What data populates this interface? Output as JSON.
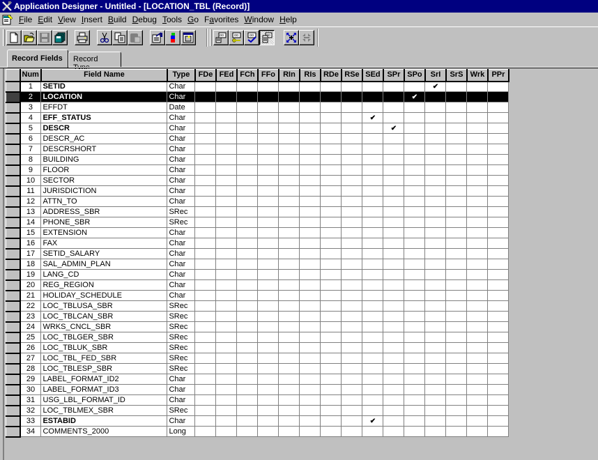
{
  "window": {
    "title": "Application Designer - Untitled - [LOCATION_TBL (Record)]"
  },
  "menu": [
    {
      "label": "File",
      "accel": "F"
    },
    {
      "label": "Edit",
      "accel": "E"
    },
    {
      "label": "View",
      "accel": "V"
    },
    {
      "label": "Insert",
      "accel": "I"
    },
    {
      "label": "Build",
      "accel": "B"
    },
    {
      "label": "Debug",
      "accel": "D"
    },
    {
      "label": "Tools",
      "accel": "T"
    },
    {
      "label": "Go",
      "accel": "G"
    },
    {
      "label": "Favorites",
      "accel": "a"
    },
    {
      "label": "Window",
      "accel": "W"
    },
    {
      "label": "Help",
      "accel": "H"
    }
  ],
  "toolbar": {
    "buttons": [
      {
        "name": "new-icon",
        "enabled": true
      },
      {
        "name": "open-icon",
        "enabled": true
      },
      {
        "name": "save-icon",
        "enabled": false
      },
      {
        "name": "save-all-icon",
        "enabled": true
      },
      {
        "name": "print-icon",
        "enabled": true
      },
      {
        "name": "cut-icon",
        "enabled": true
      },
      {
        "name": "copy-icon",
        "enabled": true
      },
      {
        "name": "paste-icon",
        "enabled": false
      },
      {
        "name": "properties-icon",
        "enabled": true
      },
      {
        "name": "build-icon",
        "enabled": true
      },
      {
        "name": "project-icon",
        "enabled": true
      },
      {
        "name": "view-field-display-icon",
        "enabled": true
      },
      {
        "name": "view-key-icon",
        "enabled": true
      },
      {
        "name": "view-validation-icon",
        "enabled": true
      },
      {
        "name": "view-pcode-icon",
        "enabled": true,
        "pressed": true
      },
      {
        "name": "expand-icon",
        "enabled": true
      },
      {
        "name": "collapse-icon",
        "enabled": false
      }
    ]
  },
  "tabs": [
    {
      "label": "Record Fields",
      "active": true
    },
    {
      "label": "Record Type",
      "active": false
    }
  ],
  "grid": {
    "columns": [
      "Num",
      "Field Name",
      "Type",
      "FDe",
      "FEd",
      "FCh",
      "FFo",
      "RIn",
      "RIs",
      "RDe",
      "RSe",
      "SEd",
      "SPr",
      "SPo",
      "SrI",
      "SrS",
      "Wrk",
      "PPr"
    ],
    "check_mark": "✔",
    "selected_row": 2,
    "rows": [
      {
        "num": "1",
        "name": "SETID",
        "type": "Char",
        "bold": true,
        "checks": [
          "SrI"
        ]
      },
      {
        "num": "2",
        "name": "LOCATION",
        "type": "Char",
        "bold": true,
        "checks": [
          "SPo"
        ]
      },
      {
        "num": "3",
        "name": "EFFDT",
        "type": "Date",
        "bold": false,
        "checks": []
      },
      {
        "num": "4",
        "name": "EFF_STATUS",
        "type": "Char",
        "bold": true,
        "checks": [
          "SEd"
        ]
      },
      {
        "num": "5",
        "name": "DESCR",
        "type": "Char",
        "bold": true,
        "checks": [
          "SPr"
        ]
      },
      {
        "num": "6",
        "name": "DESCR_AC",
        "type": "Char",
        "bold": false,
        "checks": []
      },
      {
        "num": "7",
        "name": "DESCRSHORT",
        "type": "Char",
        "bold": false,
        "checks": []
      },
      {
        "num": "8",
        "name": "BUILDING",
        "type": "Char",
        "bold": false,
        "checks": []
      },
      {
        "num": "9",
        "name": "FLOOR",
        "type": "Char",
        "bold": false,
        "checks": []
      },
      {
        "num": "10",
        "name": "SECTOR",
        "type": "Char",
        "bold": false,
        "checks": []
      },
      {
        "num": "11",
        "name": "JURISDICTION",
        "type": "Char",
        "bold": false,
        "checks": []
      },
      {
        "num": "12",
        "name": "ATTN_TO",
        "type": "Char",
        "bold": false,
        "checks": []
      },
      {
        "num": "13",
        "name": "ADDRESS_SBR",
        "type": "SRec",
        "bold": false,
        "checks": []
      },
      {
        "num": "14",
        "name": "PHONE_SBR",
        "type": "SRec",
        "bold": false,
        "checks": []
      },
      {
        "num": "15",
        "name": "EXTENSION",
        "type": "Char",
        "bold": false,
        "checks": []
      },
      {
        "num": "16",
        "name": "FAX",
        "type": "Char",
        "bold": false,
        "checks": []
      },
      {
        "num": "17",
        "name": "SETID_SALARY",
        "type": "Char",
        "bold": false,
        "checks": []
      },
      {
        "num": "18",
        "name": "SAL_ADMIN_PLAN",
        "type": "Char",
        "bold": false,
        "checks": []
      },
      {
        "num": "19",
        "name": "LANG_CD",
        "type": "Char",
        "bold": false,
        "checks": []
      },
      {
        "num": "20",
        "name": "REG_REGION",
        "type": "Char",
        "bold": false,
        "checks": []
      },
      {
        "num": "21",
        "name": "HOLIDAY_SCHEDULE",
        "type": "Char",
        "bold": false,
        "checks": []
      },
      {
        "num": "22",
        "name": "LOC_TBLUSA_SBR",
        "type": "SRec",
        "bold": false,
        "checks": []
      },
      {
        "num": "23",
        "name": "LOC_TBLCAN_SBR",
        "type": "SRec",
        "bold": false,
        "checks": []
      },
      {
        "num": "24",
        "name": "WRKS_CNCL_SBR",
        "type": "SRec",
        "bold": false,
        "checks": []
      },
      {
        "num": "25",
        "name": "LOC_TBLGER_SBR",
        "type": "SRec",
        "bold": false,
        "checks": []
      },
      {
        "num": "26",
        "name": "LOC_TBLUK_SBR",
        "type": "SRec",
        "bold": false,
        "checks": []
      },
      {
        "num": "27",
        "name": "LOC_TBL_FED_SBR",
        "type": "SRec",
        "bold": false,
        "checks": []
      },
      {
        "num": "28",
        "name": "LOC_TBLESP_SBR",
        "type": "SRec",
        "bold": false,
        "checks": []
      },
      {
        "num": "29",
        "name": "LABEL_FORMAT_ID2",
        "type": "Char",
        "bold": false,
        "checks": []
      },
      {
        "num": "30",
        "name": "LABEL_FORMAT_ID3",
        "type": "Char",
        "bold": false,
        "checks": []
      },
      {
        "num": "31",
        "name": "USG_LBL_FORMAT_ID",
        "type": "Char",
        "bold": false,
        "checks": []
      },
      {
        "num": "32",
        "name": "LOC_TBLMEX_SBR",
        "type": "SRec",
        "bold": false,
        "checks": []
      },
      {
        "num": "33",
        "name": "ESTABID",
        "type": "Char",
        "bold": true,
        "checks": [
          "SEd"
        ]
      },
      {
        "num": "34",
        "name": "COMMENTS_2000",
        "type": "Long",
        "bold": false,
        "checks": []
      }
    ]
  }
}
